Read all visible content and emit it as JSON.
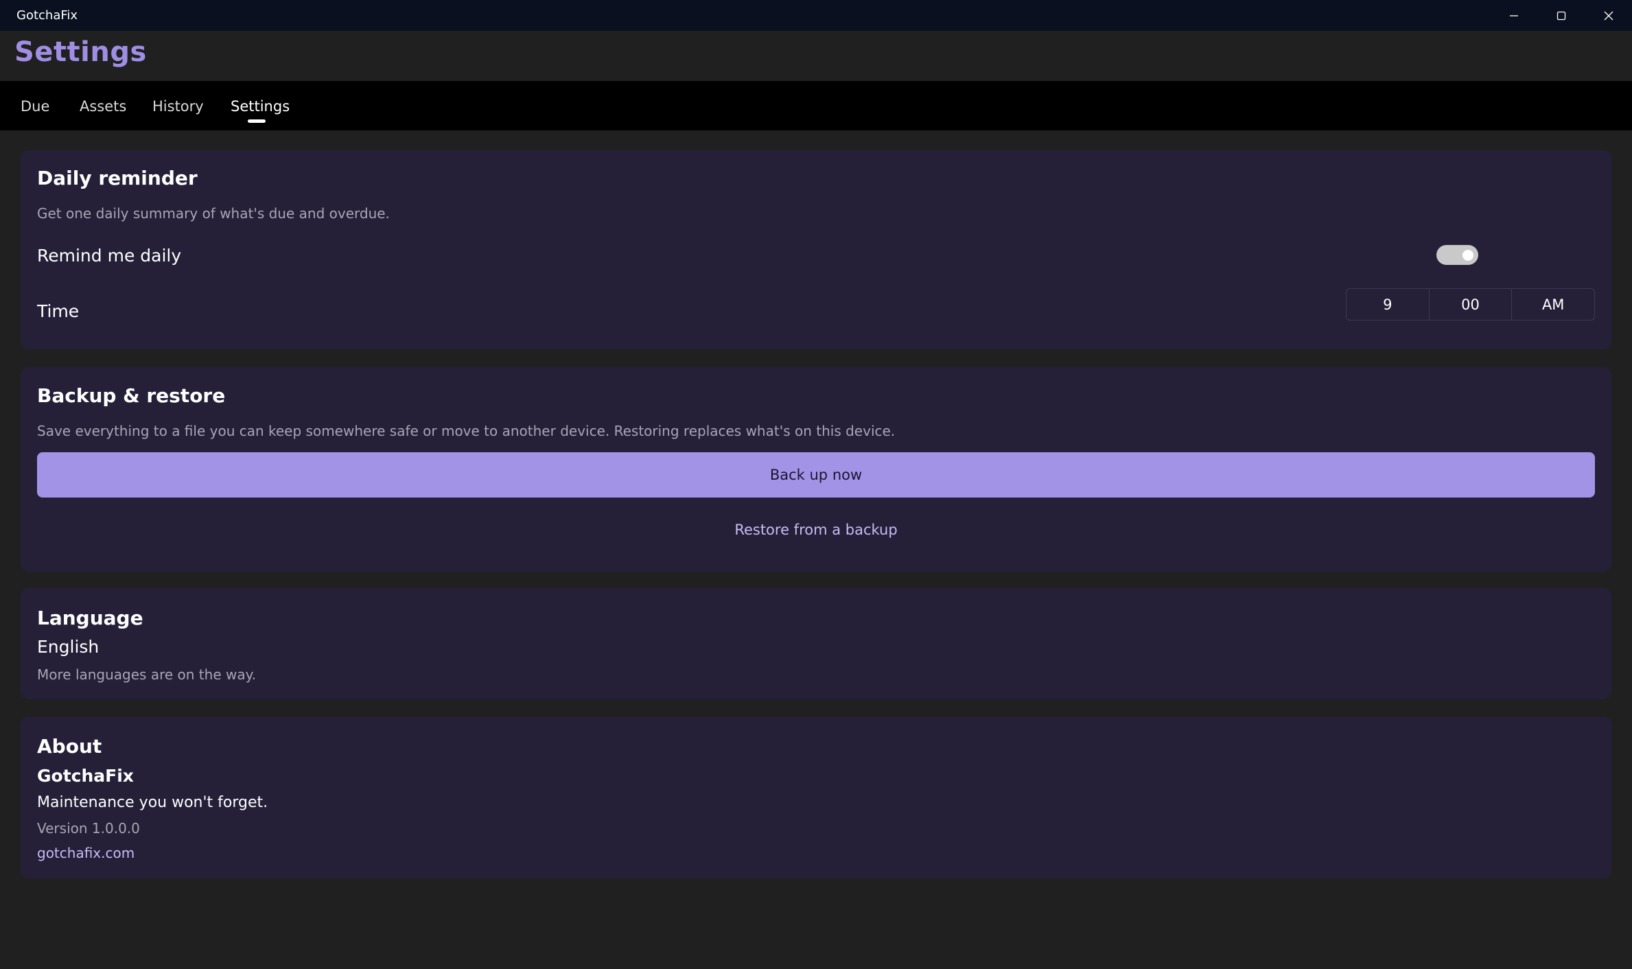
{
  "window": {
    "app_name": "GotchaFix",
    "controls": [
      "minimize-icon",
      "maximize-icon",
      "close-icon"
    ]
  },
  "header": {
    "title": "Settings"
  },
  "nav": {
    "tabs": [
      {
        "label": "Due",
        "active": false
      },
      {
        "label": "Assets",
        "active": false
      },
      {
        "label": "History",
        "active": false
      },
      {
        "label": "Settings",
        "active": true
      }
    ]
  },
  "daily_reminder": {
    "title": "Daily reminder",
    "description": "Get one daily summary of what's due and overdue.",
    "remind_label": "Remind me daily",
    "remind_enabled": true,
    "time_label": "Time",
    "time": {
      "hour": "9",
      "minute": "00",
      "period": "AM"
    }
  },
  "backup": {
    "title": "Backup & restore",
    "description": "Save everything to a file you can keep somewhere safe or move to another device. Restoring replaces what's on this device.",
    "backup_button": "Back up now",
    "restore_button": "Restore from a backup"
  },
  "language": {
    "title": "Language",
    "current": "English",
    "note": "More languages are on the way."
  },
  "about": {
    "title": "About",
    "app_name": "GotchaFix",
    "tagline": "Maintenance you won't forget.",
    "version": "Version 1.0.0.0",
    "website": "gotchafix.com"
  },
  "colors": {
    "accent": "#a393e6",
    "title_accent": "#9f8ee3",
    "card_bg": "#252038",
    "page_bg": "#202020",
    "link": "#c7bcf5"
  }
}
